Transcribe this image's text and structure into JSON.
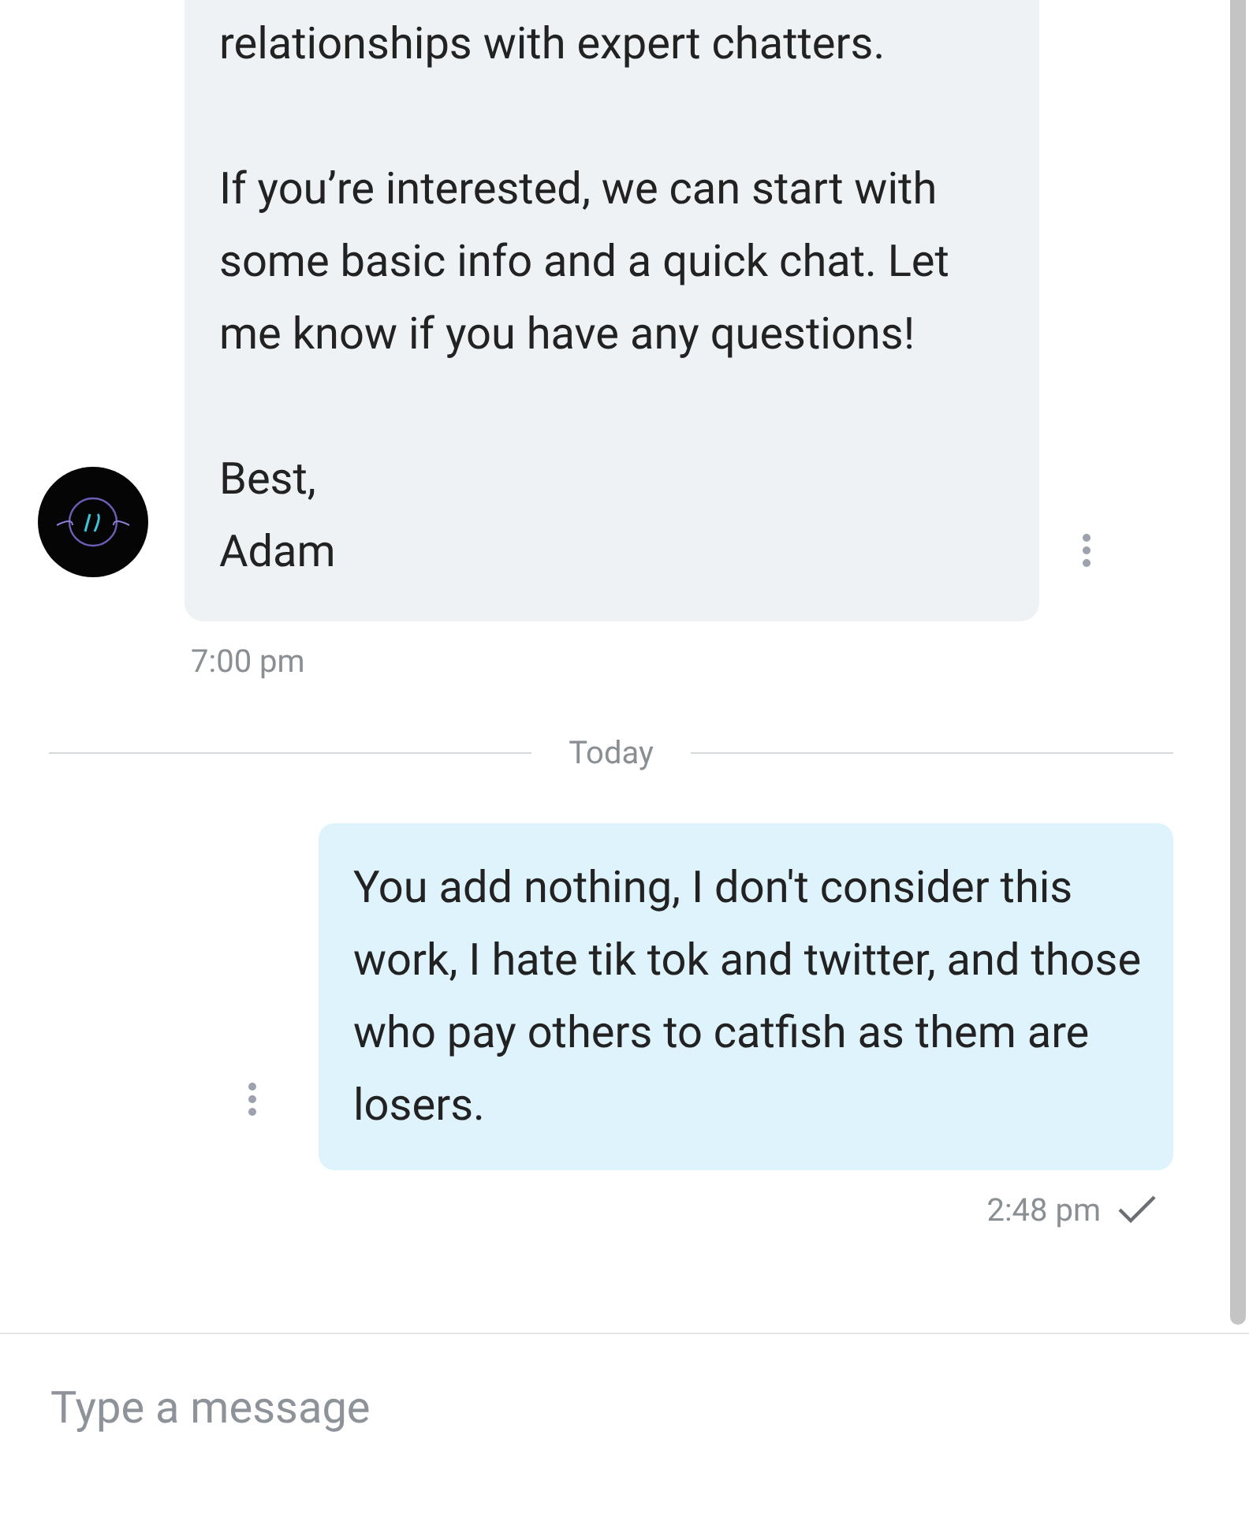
{
  "messages": [
    {
      "kind": "received",
      "paragraphs": [
        "relationships with expert chatters.",
        "If you’re interested, we can start with some basic info and a quick chat. Let me know if you have any questions!",
        "Best,\nAdam"
      ],
      "time": "7:00 pm"
    },
    {
      "kind": "divider",
      "label": "Today"
    },
    {
      "kind": "sent",
      "paragraphs": [
        "You add nothing, I don't consider this work, I hate tik tok and twitter, and those who pay others to catfish as them are losers."
      ],
      "time": "2:48 pm",
      "delivered": true
    }
  ],
  "composer": {
    "placeholder": "Type a message"
  }
}
